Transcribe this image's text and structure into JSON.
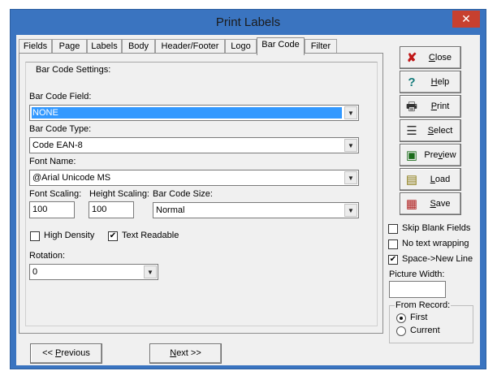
{
  "window": {
    "title": "Print Labels",
    "close_glyph": "✕"
  },
  "tabs": [
    {
      "label": "Fields"
    },
    {
      "label": "Page"
    },
    {
      "label": "Labels"
    },
    {
      "label": "Body"
    },
    {
      "label": "Header/Footer"
    },
    {
      "label": "Logo"
    },
    {
      "label": "Bar Code"
    },
    {
      "label": "Filter"
    }
  ],
  "barcode": {
    "group_title": "Bar Code Settings:",
    "field_label": "Bar Code Field:",
    "field_value": "NONE",
    "type_label": "Bar Code Type:",
    "type_value": "Code EAN-8",
    "font_label": "Font Name:",
    "font_value": "@Arial Unicode MS",
    "font_scaling_label": "Font Scaling:",
    "font_scaling_value": "100",
    "height_scaling_label": "Height Scaling:",
    "height_scaling_value": "100",
    "size_label": "Bar Code Size:",
    "size_value": "Normal",
    "high_density_label": "High Density",
    "high_density_checked": false,
    "text_readable_label": "Text Readable",
    "text_readable_checked": true,
    "rotation_label": "Rotation:",
    "rotation_value": "0"
  },
  "side_buttons": {
    "close": {
      "pre": "",
      "u": "C",
      "post": "lose",
      "icon": "✘",
      "color": "#c01818"
    },
    "help": {
      "pre": "",
      "u": "H",
      "post": "elp",
      "icon": "?",
      "color": "#137a7a"
    },
    "print": {
      "pre": "",
      "u": "P",
      "post": "rint",
      "icon": "🖶",
      "color": "#333333"
    },
    "select": {
      "pre": "",
      "u": "S",
      "post": "elect",
      "icon": "☰",
      "color": "#333333"
    },
    "preview": {
      "pre": "Pre",
      "u": "v",
      "post": "iew",
      "icon": "▣",
      "color": "#1a6b1a"
    },
    "load": {
      "pre": "",
      "u": "L",
      "post": "oad",
      "icon": "▤",
      "color": "#8a7a10"
    },
    "save": {
      "pre": "",
      "u": "S",
      "post": "ave",
      "icon": "▦",
      "color": "#b02020"
    }
  },
  "options": {
    "skip_blank_label": "Skip Blank Fields",
    "skip_blank_checked": false,
    "no_wrap_label": "No text wrapping",
    "no_wrap_checked": false,
    "space_newline_label": "Space->New Line",
    "space_newline_checked": true,
    "picture_width_label": "Picture Width:",
    "picture_width_value": ""
  },
  "from_record": {
    "title": "From Record:",
    "first_label": "First",
    "current_label": "Current",
    "selected": "First"
  },
  "nav": {
    "previous_pre": "<< ",
    "previous_u": "P",
    "previous_post": "revious",
    "next_u": "N",
    "next_post": "ext >>"
  },
  "icons": {
    "dropdown": "▼",
    "check": "✔"
  }
}
